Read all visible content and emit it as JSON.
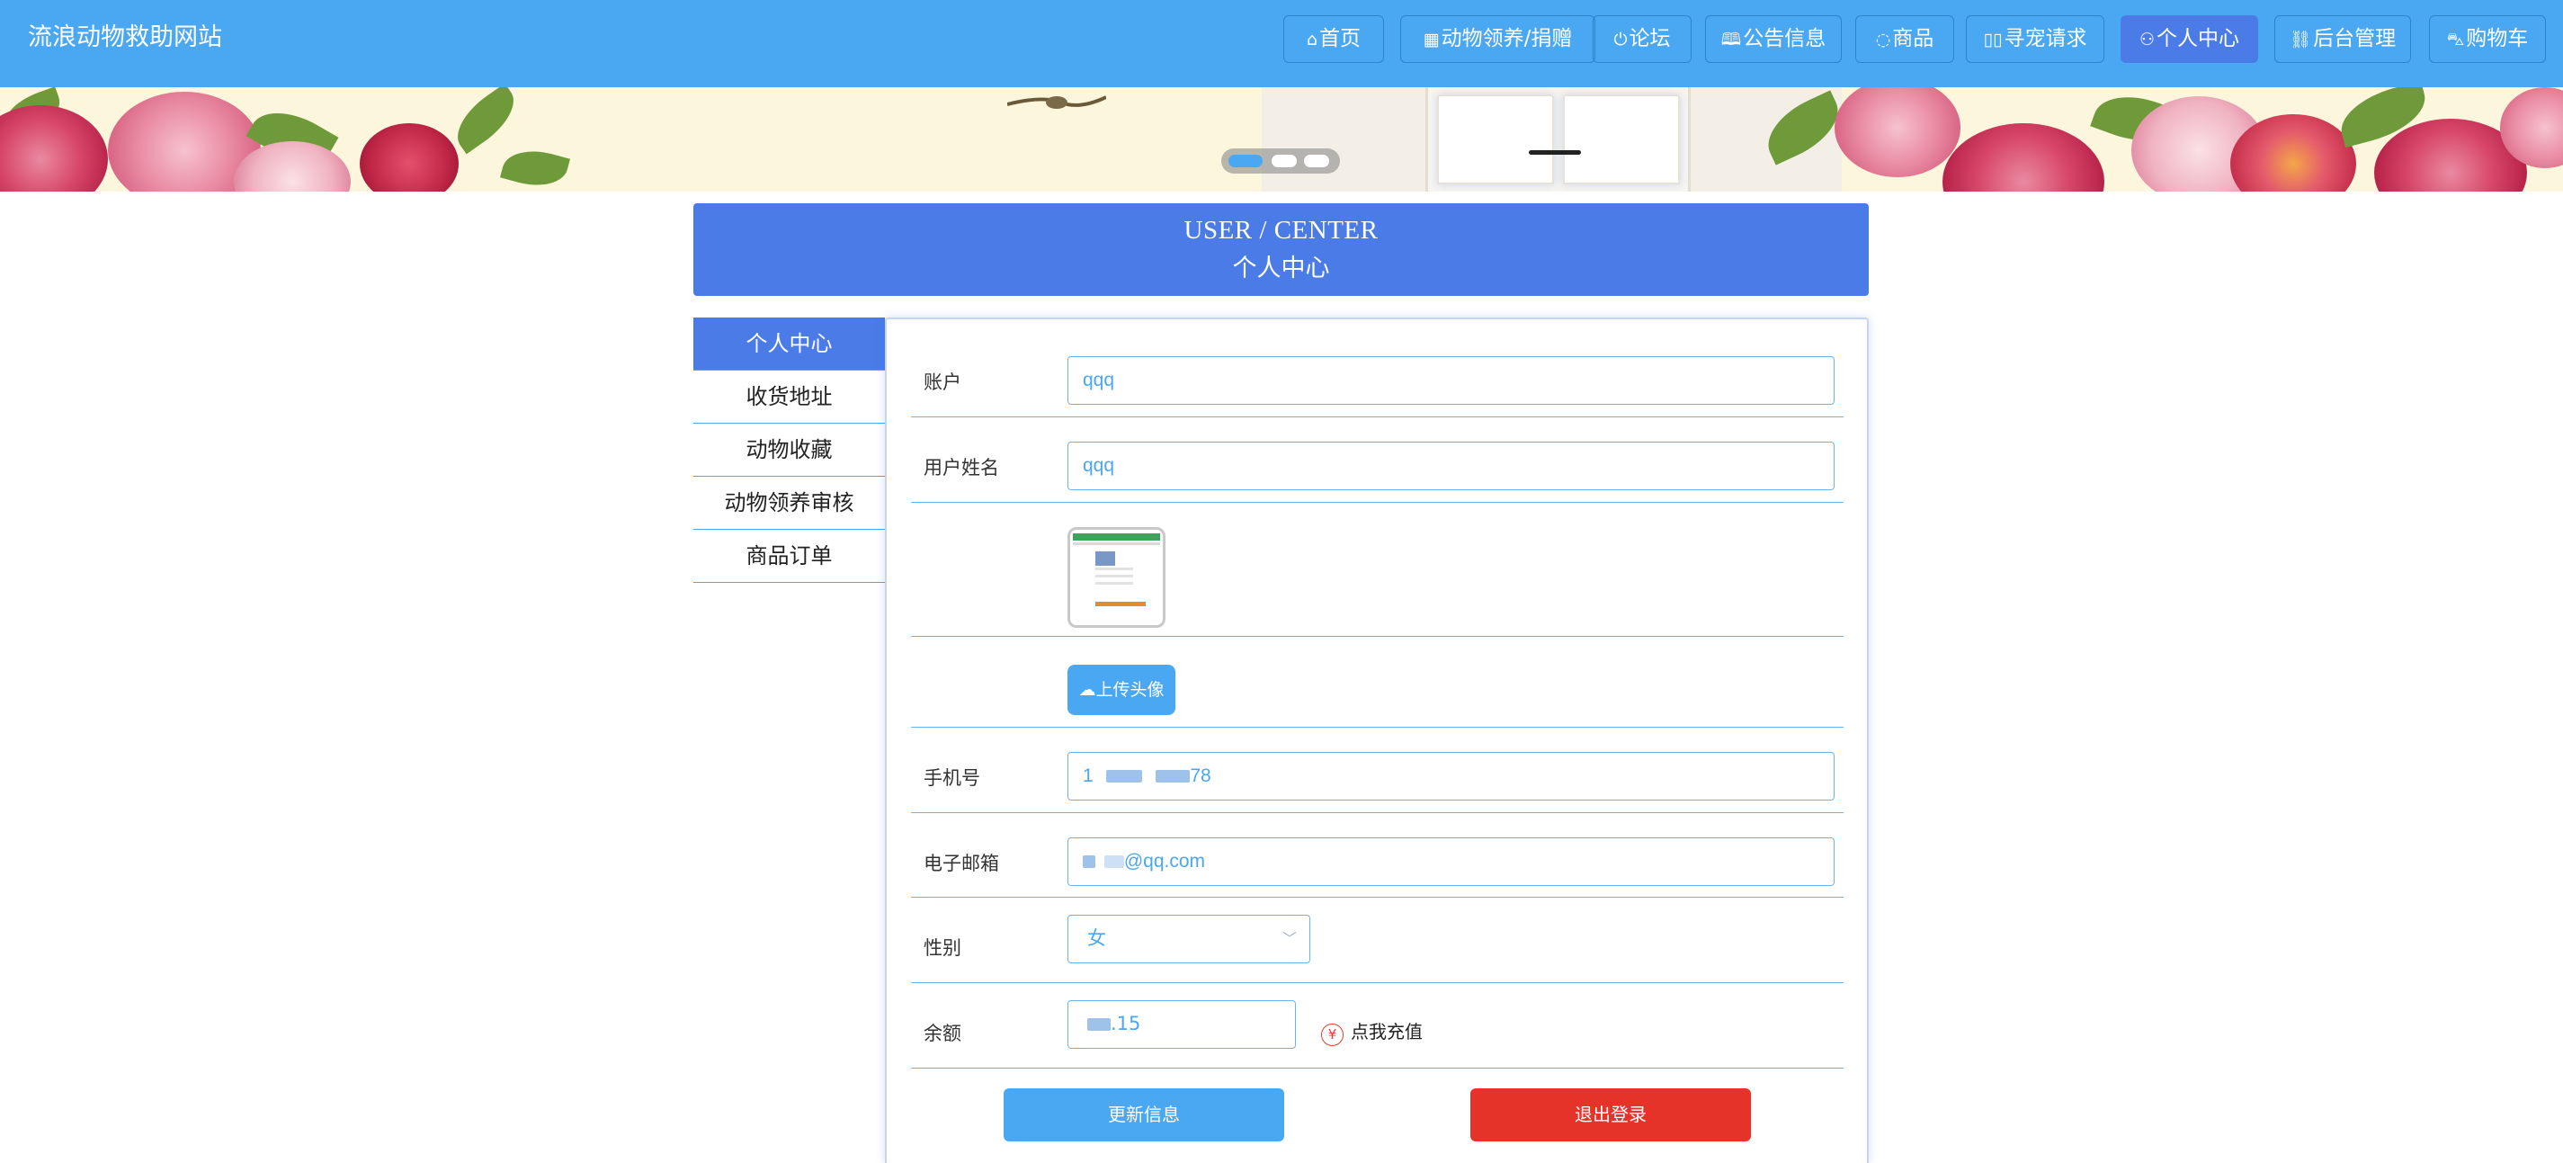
{
  "site": {
    "title": "流浪动物救助网站"
  },
  "nav": [
    {
      "icon": "home-icon",
      "glyph": "⌂",
      "label": "首页"
    },
    {
      "icon": "grid-icon",
      "glyph": "▦",
      "label": "动物领养/捐赠"
    },
    {
      "icon": "power-icon",
      "glyph": "⏻",
      "label": "论坛"
    },
    {
      "icon": "book-icon",
      "glyph": "📖",
      "label": "公告信息"
    },
    {
      "icon": "chat-icon",
      "glyph": "💬",
      "label": "商品"
    },
    {
      "icon": "columns-icon",
      "glyph": "▯▯",
      "label": "寻宠请求"
    },
    {
      "icon": "user-icon",
      "glyph": "👤",
      "label": "个人中心",
      "active": true
    },
    {
      "icon": "link-icon",
      "glyph": "🔗",
      "label": "后台管理"
    },
    {
      "icon": "cart-icon",
      "glyph": "🛒",
      "label": "购物车"
    }
  ],
  "header": {
    "en": "USER / CENTER",
    "zh": "个人中心"
  },
  "side_menu": [
    {
      "label": "个人中心",
      "active": true
    },
    {
      "label": "收货地址"
    },
    {
      "label": "动物收藏"
    },
    {
      "label": "动物领养审核"
    },
    {
      "label": "商品订单"
    }
  ],
  "form": {
    "account_label": "账户",
    "account_value": "qqq",
    "name_label": "用户姓名",
    "name_value": "qqq",
    "upload_label": "上传头像",
    "phone_label": "手机号",
    "phone_prefix": "1",
    "phone_suffix": "78",
    "email_label": "电子邮箱",
    "email_suffix": "@qq.com",
    "gender_label": "性别",
    "gender_value": "女",
    "balance_label": "余额",
    "balance_suffix": ".15",
    "recharge_label": "点我充值",
    "recharge_icon": "¥"
  },
  "buttons": {
    "update": "更新信息",
    "logout": "退出登录"
  },
  "colors": {
    "nav_bg": "#4aa7f1",
    "accent": "#4b7be6",
    "danger": "#e6332a",
    "field_border": "#6db3ec"
  }
}
